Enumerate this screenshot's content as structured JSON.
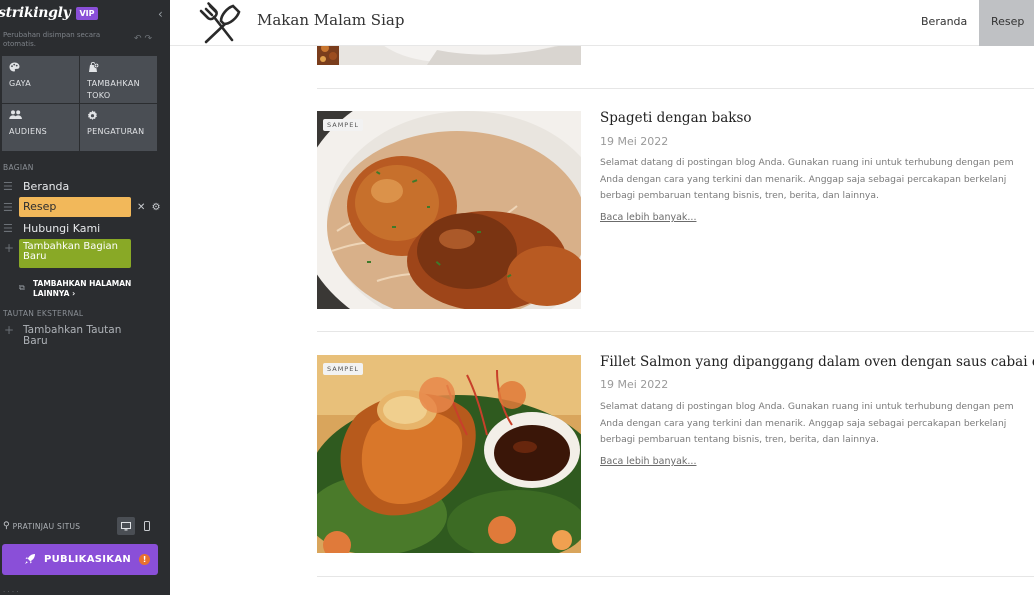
{
  "editor": {
    "brand": "strikingly",
    "vip_badge": "VIP",
    "autosave_note": "Perubahan disimpan secara otomatis.",
    "tiles": [
      {
        "label": "GAYA",
        "icon": "palette-icon"
      },
      {
        "label": "TAMBAHKAN TOKO",
        "icon": "store-icon"
      },
      {
        "label": "AUDIENS",
        "icon": "people-icon"
      },
      {
        "label": "PENGATURAN",
        "icon": "gear-icon"
      }
    ],
    "sections_heading": "BAGIAN",
    "sections": [
      "Beranda",
      "Resep",
      "Hubungi Kami"
    ],
    "active_section": "Resep",
    "add_section": "Tambahkan Bagian Baru",
    "add_page": "TAMBAHKAN HALAMAN LAINNYA",
    "external_links_heading": "TAUTAN EKSTERNAL",
    "add_external_link": "Tambahkan Tautan Baru",
    "preview_label": "PRATINJAU SITUS",
    "publish_label": "PUBLIKASIKAN",
    "publish_warning": "!",
    "colors": {
      "sidebar_bg": "#2b2d30",
      "tile_bg": "#4a4e54",
      "active_section": "#f2b85a",
      "add_section": "#89a926",
      "publish": "#8a4fd8",
      "warning": "#e8712f"
    }
  },
  "site": {
    "title": "Makan Malam Siap",
    "logo_icon": "fork-knife-icon",
    "menu": [
      "Beranda",
      "Resep"
    ],
    "active_menu": "Resep",
    "posts": [
      {
        "badge": "SAMPEL",
        "title": "Spageti dengan bakso",
        "date": "19 Mei 2022",
        "excerpt_lines": [
          "Selamat datang di postingan blog Anda. Gunakan ruang ini untuk terhubung dengan pem",
          "Anda dengan cara yang terkini dan menarik. Anggap saja sebagai percakapan berkelanj",
          "berbagi pembaruan tentang bisnis, tren, berita, dan lainnya."
        ],
        "read_more": "Baca lebih banyak..."
      },
      {
        "badge": "SAMPEL",
        "title": "Fillet Salmon yang dipanggang dalam oven dengan saus cabai dan k",
        "date": "19 Mei 2022",
        "excerpt_lines": [
          "Selamat datang di postingan blog Anda. Gunakan ruang ini untuk terhubung dengan pem",
          "Anda dengan cara yang terkini dan menarik. Anggap saja sebagai percakapan berkelanj",
          "berbagi pembaruan tentang bisnis, tren, berita, dan lainnya."
        ],
        "read_more": "Baca lebih banyak..."
      }
    ]
  }
}
